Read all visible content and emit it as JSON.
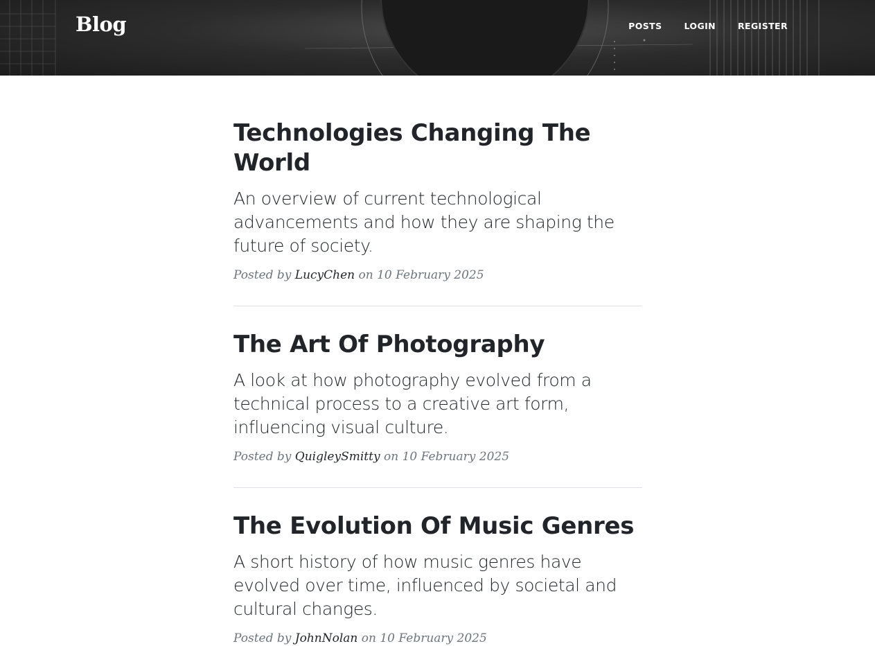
{
  "brand": "Blog",
  "nav": {
    "posts": "POSTS",
    "login": "LOGIN",
    "register": "REGISTER"
  },
  "posts": [
    {
      "title": "Technologies Changing The World",
      "subtitle": "An overview of current technological advancements and how they are shaping the future of society.",
      "posted_by": "Posted by",
      "author": "LucyChen",
      "on": "on",
      "date": "10 February 2025"
    },
    {
      "title": "The Art Of Photography",
      "subtitle": "A look at how photography evolved from a technical process to a creative art form, influencing visual culture.",
      "posted_by": "Posted by",
      "author": "QuigleySmitty",
      "on": "on",
      "date": "10 February 2025"
    },
    {
      "title": "The Evolution Of Music Genres",
      "subtitle": "A short history of how music genres have evolved over time, influenced by societal and cultural changes.",
      "posted_by": "Posted by",
      "author": "JohnNolan",
      "on": "on",
      "date": "10 February 2025"
    }
  ]
}
